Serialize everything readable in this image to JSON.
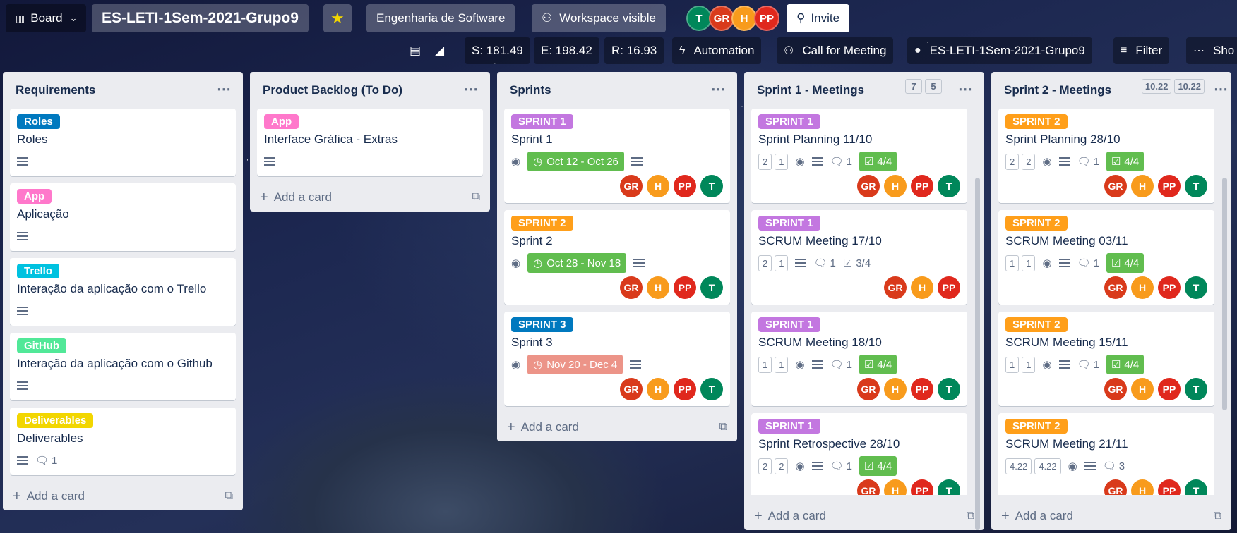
{
  "topbar": {
    "view_label": "Board",
    "board_name": "ES-LETI-1Sem-2021-Grupo9",
    "workspace": "Engenharia de Software",
    "visibility": "Workspace visible",
    "invite": "Invite",
    "avatars": [
      {
        "initials": "T",
        "color": "#00875a"
      },
      {
        "initials": "GR",
        "color": "#d93a1b"
      },
      {
        "initials": "H",
        "color": "#f89b1c"
      },
      {
        "initials": "PP",
        "color": "#e0281d"
      }
    ]
  },
  "secondbar": {
    "s_value": "S: 181.49",
    "e_value": "E: 198.42",
    "r_value": "R: 16.93",
    "automation": "Automation",
    "call_meeting": "Call for Meeting",
    "github": "ES-LETI-1Sem-2021-Grupo9",
    "filter": "Filter",
    "show": "Sho"
  },
  "lists": {
    "requirements": {
      "title": "Requirements",
      "add": "Add a card",
      "cards": [
        {
          "label": "Roles",
          "label_color": "#0079bf",
          "title": "Roles"
        },
        {
          "label": "App",
          "label_color": "#ff78cb",
          "title": "Aplicação"
        },
        {
          "label": "Trello",
          "label_color": "#00c2e0",
          "title": "Interação da aplicação com o Trello"
        },
        {
          "label": "GitHub",
          "label_color": "#51e898",
          "title": "Interação da aplicação com o Github"
        },
        {
          "label": "Deliverables",
          "label_color": "#f2d600",
          "title": "Deliverables",
          "comments": "1"
        }
      ]
    },
    "backlog": {
      "title": "Product Backlog (To Do)",
      "add": "Add a card",
      "cards": [
        {
          "label": "App",
          "label_color": "#ff78cb",
          "title": "Interface Gráfica - Extras"
        }
      ]
    },
    "sprints": {
      "title": "Sprints",
      "add": "Add a card",
      "cards": [
        {
          "label": "SPRINT 1",
          "label_color": "#c377e0",
          "title": "Sprint 1",
          "date": "Oct 12 - Oct 26",
          "date_color": "#61bd4f"
        },
        {
          "label": "SPRINT 2",
          "label_color": "#ff9f1a",
          "title": "Sprint 2",
          "date": "Oct 28 - Nov 18",
          "date_color": "#61bd4f"
        },
        {
          "label": "SPRINT 3",
          "label_color": "#0079bf",
          "title": "Sprint 3",
          "date": "Nov 20 - Dec 4",
          "date_color": "#ec9488"
        }
      ]
    },
    "sprint1": {
      "title": "Sprint 1 - Meetings",
      "count_a": "7",
      "count_b": "5",
      "add": "Add a card",
      "cards": [
        {
          "label": "SPRINT 1",
          "title": "Sprint Planning 11/10",
          "n1": "2",
          "n2": "1",
          "comments": "1",
          "check": "4/4"
        },
        {
          "label": "SPRINT 1",
          "title": "SCRUM Meeting 17/10",
          "n1": "2",
          "n2": "1",
          "comments": "1",
          "check": "3/4"
        },
        {
          "label": "SPRINT 1",
          "title": "SCRUM Meeting 18/10",
          "n1": "1",
          "n2": "1",
          "comments": "1",
          "check": "4/4"
        },
        {
          "label": "SPRINT 1",
          "title": "Sprint Retrospective 28/10",
          "n1": "2",
          "n2": "2",
          "comments": "1",
          "check": "4/4"
        }
      ]
    },
    "sprint2": {
      "title": "Sprint 2 - Meetings",
      "count_a": "10.22",
      "count_b": "10.22",
      "add": "Add a card",
      "cards": [
        {
          "label": "SPRINT 2",
          "title": "Sprint Planning 28/10",
          "n1": "2",
          "n2": "2",
          "comments": "1",
          "check": "4/4"
        },
        {
          "label": "SPRINT 2",
          "title": "SCRUM Meeting 03/11",
          "n1": "1",
          "n2": "1",
          "comments": "1",
          "check": "4/4"
        },
        {
          "label": "SPRINT 2",
          "title": "SCRUM Meeting 15/11",
          "n1": "1",
          "n2": "1",
          "comments": "1",
          "check": "4/4"
        },
        {
          "label": "SPRINT 2",
          "title": "SCRUM Meeting 21/11",
          "n1": "4.22",
          "n2": "4.22",
          "comments": "3"
        }
      ]
    }
  },
  "members": {
    "GR": {
      "initials": "GR",
      "color": "#d93a1b"
    },
    "H": {
      "initials": "H",
      "color": "#f89b1c"
    },
    "PP": {
      "initials": "PP",
      "color": "#e0281d"
    },
    "T": {
      "initials": "T",
      "color": "#00875a"
    }
  }
}
